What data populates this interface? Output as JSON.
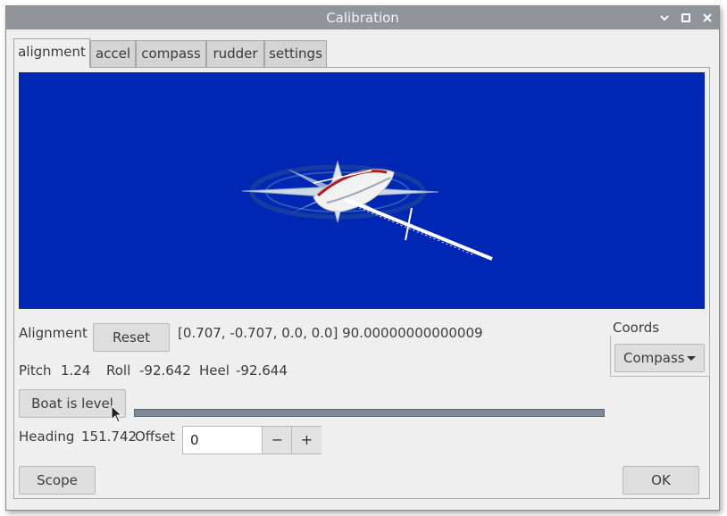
{
  "window": {
    "title": "Calibration"
  },
  "tabs": [
    {
      "label": "alignment",
      "active": true
    },
    {
      "label": "accel",
      "active": false
    },
    {
      "label": "compass",
      "active": false
    },
    {
      "label": "rudder",
      "active": false
    },
    {
      "label": "settings",
      "active": false
    }
  ],
  "alignment": {
    "label": "Alignment",
    "reset_label": "Reset",
    "value": "[0.707, -0.707, 0.0, 0.0] 90.00000000000009"
  },
  "attitude": {
    "pitch_label": "Pitch",
    "pitch_value": "1.24",
    "roll_label": "Roll",
    "roll_value": "-92.642",
    "heel_label": "Heel",
    "heel_value": "-92.644"
  },
  "level": {
    "button_label": "Boat is level",
    "progress": 0
  },
  "heading": {
    "label": "Heading",
    "value": "151.742",
    "offset_label": "Offset",
    "offset_value": "0",
    "decrement": "−",
    "increment": "+"
  },
  "coords": {
    "group_label": "Coords",
    "selected": "Compass"
  },
  "footer": {
    "scope_label": "Scope",
    "ok_label": "OK"
  },
  "colors": {
    "viewport_bg": "#0027b3",
    "titlebar": "#8f959a"
  }
}
